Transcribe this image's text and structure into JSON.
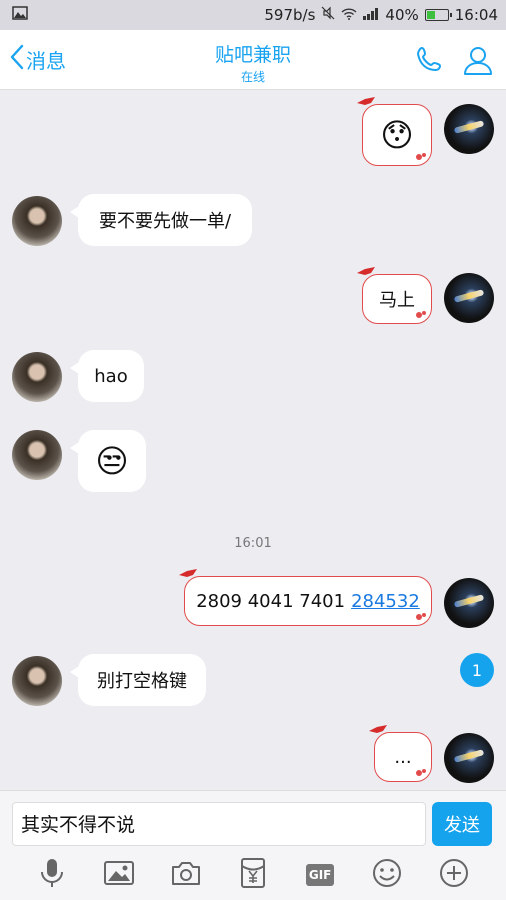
{
  "status_bar": {
    "speed": "597b/s",
    "battery": "40%",
    "battery_level": 0.4,
    "time": "16:04"
  },
  "header": {
    "back_label": "消息",
    "title": "贴吧兼职",
    "subtitle": "在线"
  },
  "messages": [
    {
      "from": "me",
      "type": "emoji",
      "emoji": "😯"
    },
    {
      "from": "other",
      "type": "text",
      "text": "要不要先做一单/"
    },
    {
      "from": "me",
      "type": "text",
      "text": "马上"
    },
    {
      "from": "other",
      "type": "text",
      "text": "hao"
    },
    {
      "from": "other",
      "type": "emoji",
      "emoji": "😒"
    },
    {
      "type": "timestamp",
      "text": "16:01"
    },
    {
      "from": "me",
      "type": "text",
      "text": "2809 4041 7401",
      "link": "284532"
    },
    {
      "from": "other",
      "type": "text",
      "text": "别打空格键"
    },
    {
      "from": "me",
      "type": "text",
      "text": "..."
    }
  ],
  "unread_count": "1",
  "input": {
    "value": "其实不得不说",
    "send_label": "发送"
  },
  "toolbar": {
    "gif_label": "GIF"
  },
  "colors": {
    "accent": "#16a3ee",
    "bubble_border": "#e24b4b",
    "background": "#ececf1"
  }
}
